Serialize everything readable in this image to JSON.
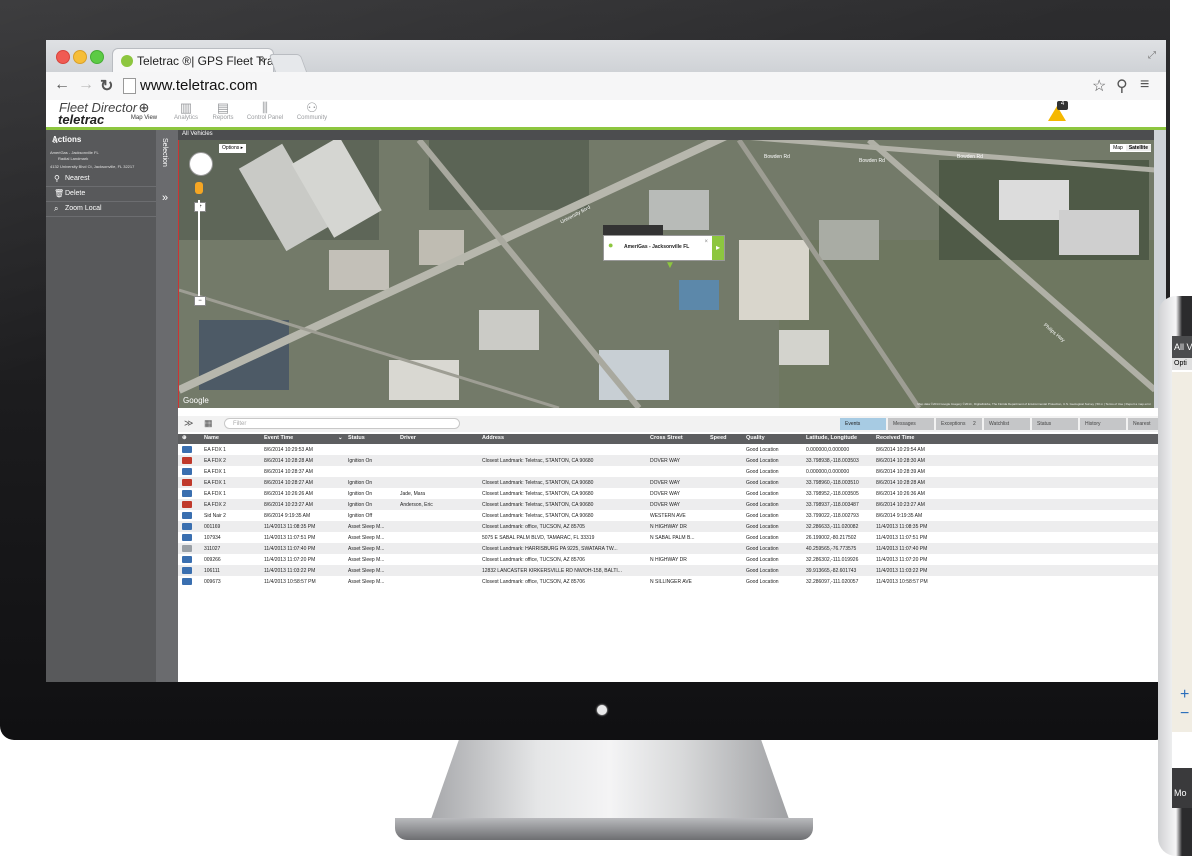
{
  "browser": {
    "tab_title": "Teletrac ®| GPS Fleet Track",
    "url": "www.teletrac.com",
    "close_glyph": "×"
  },
  "app": {
    "logo_line1": "Fleet Director",
    "logo_line2": "teletrac",
    "nav": [
      {
        "label": "Map View",
        "icon": "globe-icon",
        "active": true
      },
      {
        "label": "Analytics",
        "icon": "analytics-icon",
        "active": false
      },
      {
        "label": "Reports",
        "icon": "reports-icon",
        "active": false
      },
      {
        "label": "Control Panel",
        "icon": "sliders-icon",
        "active": false
      },
      {
        "label": "Community",
        "icon": "community-icon",
        "active": false
      }
    ],
    "alert_count": "4",
    "accent_color": "#8dc63f"
  },
  "left_panel": {
    "actions_title": "Actions",
    "location_line1": "AmeriGas - Jacksonville FL",
    "location_line2": "Radial Landmark",
    "location_line3": "4132 University Blvd Ct, Jacksonville, FL 32217",
    "items": [
      {
        "label": "Nearest",
        "icon": "pin-icon"
      },
      {
        "label": "Delete",
        "icon": "trash-icon"
      },
      {
        "label": "Zoom Local",
        "icon": "search-icon"
      }
    ],
    "selection_label": "Selection"
  },
  "map": {
    "header": "All Vehicles",
    "options_label": "Options",
    "map_types": [
      "Map",
      "Satellite"
    ],
    "popup_text": "AmeriGas - Jacksonville FL",
    "google_label": "Google",
    "credit": "Map data ©2014 Google Imagery ©2014 , DigitalGlobe, The Florida Department of Environmental Protection, U.S. Geological Survey | 50 m | Terms of Use | Report a map error",
    "streets": [
      "Bowden Rd",
      "Bowden Rd",
      "Bowden Rd",
      "University Blvd",
      "Philips Hwy"
    ]
  },
  "grid": {
    "filter_placeholder": "Filter",
    "tabs": [
      "Events",
      "Messages",
      "Exceptions",
      "Watchlist",
      "Status",
      "History",
      "Nearest"
    ],
    "exceptions_count": "2",
    "columns": [
      "Name",
      "Event Time",
      "Status",
      "Driver",
      "Address",
      "Cross Street",
      "Speed",
      "Quality",
      "Latitude, Longitude",
      "Received Time"
    ],
    "rows": [
      [
        "EA FDX 1",
        "8/6/2014 10:29:53 AM",
        "",
        "",
        "",
        "",
        "",
        "Good Location",
        "0.000000,0.000000",
        "8/6/2014 10:29:54 AM"
      ],
      [
        "EA FDX 2",
        "8/6/2014 10:28:28 AM",
        "Ignition On",
        "",
        "Closest Landmark: Teletrac, STANTON, CA 90680",
        "DOVER WAY",
        "",
        "Good Location",
        "33.798938,-118.003503",
        "8/6/2014 10:28:30 AM"
      ],
      [
        "EA FDX 1",
        "8/6/2014 10:28:37 AM",
        "",
        "",
        "",
        "",
        "",
        "Good Location",
        "0.000000,0.000000",
        "8/6/2014 10:28:39 AM"
      ],
      [
        "EA FDX 1",
        "8/6/2014 10:28:27 AM",
        "Ignition On",
        "",
        "Closest Landmark: Teletrac, STANTON, CA 90680",
        "DOVER WAY",
        "",
        "Good Location",
        "33.798960,-118.003510",
        "8/6/2014 10:28:28 AM"
      ],
      [
        "EA FDX 1",
        "8/6/2014 10:26:26 AM",
        "Ignition On",
        "Jade, Mara",
        "Closest Landmark: Teletrac, STANTON, CA 90680",
        "DOVER WAY",
        "",
        "Good Location",
        "33.798952,-118.003505",
        "8/6/2014 10:26:36 AM"
      ],
      [
        "EA FDX 2",
        "8/6/2014 10:23:27 AM",
        "Ignition On",
        "Anderson, Eric",
        "Closest Landmark: Teletrac, STANTON, CA 90680",
        "DOVER WAY",
        "",
        "Good Location",
        "33.798937,-118.003487",
        "8/6/2014 10:23:27 AM"
      ],
      [
        "Sid Nair 2",
        "8/6/2014 9:19:35 AM",
        "Ignition Off",
        "",
        "Closest Landmark: Teletrac, STANTON, CA 90680",
        "WESTERN AVE",
        "",
        "Good Location",
        "33.799022,-118.002793",
        "8/6/2014 9:19:35 AM"
      ],
      [
        "001169",
        "11/4/2013 11:08:35 PM",
        "Asset Sleep M...",
        "",
        "Closest Landmark: office, TUCSON, AZ 85705",
        "N HIGHWAY DR",
        "",
        "Good Location",
        "32.286633,-111.020082",
        "11/4/2013 11:08:35 PM"
      ],
      [
        "107934",
        "11/4/2013 11:07:51 PM",
        "Asset Sleep M...",
        "",
        "5075 E SABAL PALM BLVD, TAMARAC, FL 33319",
        "N SABAL PALM B...",
        "",
        "Good Location",
        "26.199002,-80.217502",
        "11/4/2013 11:07:51 PM"
      ],
      [
        "311027",
        "11/4/2013 11:07:40 PM",
        "Asset Sleep M...",
        "",
        "Closest Landmark: HARRISBURG PA 9225, SWATARA TW...",
        "",
        "",
        "Good Location",
        "40.259565,-76.773575",
        "11/4/2013 11:07:40 PM"
      ],
      [
        "009266",
        "11/4/2013 11:07:20 PM",
        "Asset Sleep M...",
        "",
        "Closest Landmark: office, TUCSON, AZ 85706",
        "N HIGHWAY DR",
        "",
        "Good Location",
        "32.286302,-111.019926",
        "11/4/2013 11:07:20 PM"
      ],
      [
        "106111",
        "11/4/2013 11:03:22 PM",
        "Asset Sleep M...",
        "",
        "12832 LANCASTER KIRKERSVILLE RD NW/OH-158, BALTI...",
        "",
        "",
        "Good Location",
        "39.913665,-82.601743",
        "11/4/2013 11:03:22 PM"
      ],
      [
        "009673",
        "11/4/2013 10:58:57 PM",
        "Asset Sleep M...",
        "",
        "Closest Landmark: office, TUCSON, AZ 85706",
        "N SILLINGER AVE",
        "",
        "Good Location",
        "32.286097,-111.020057",
        "11/4/2013 10:58:57 PM"
      ]
    ]
  },
  "phone": {
    "header": "All V",
    "options": "Opti",
    "plus": "+",
    "minus": "−",
    "bottom": "Mo"
  }
}
